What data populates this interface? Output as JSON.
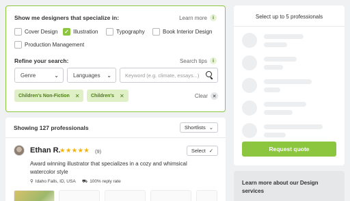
{
  "filters": {
    "specialty_question": "Show me designers that specialize in:",
    "learn_more_label": "Learn more",
    "specialties": [
      {
        "label": "Cover Design",
        "checked": false
      },
      {
        "label": "Illustration",
        "checked": true
      },
      {
        "label": "Typography",
        "checked": false
      },
      {
        "label": "Book Interior Design",
        "checked": false
      },
      {
        "label": "Production Management",
        "checked": false
      }
    ],
    "refine_label": "Refine your search:",
    "search_tips_label": "Search tips",
    "genre_select": "Genre",
    "languages_select": "Languages",
    "keyword_placeholder": "Keyword (e.g. climate, essays...)",
    "active_chips": [
      "Children's Non-Fiction",
      "Children's"
    ],
    "clear_label": "Clear"
  },
  "results": {
    "count_label": "Showing 127 professionals",
    "shortlists_label": "Shortlists",
    "professional": {
      "name": "Ethan R.",
      "stars": "★★★★★",
      "rating": 5,
      "review_count": "(9)",
      "select_label": "Select",
      "description": "Award winning illustrator that specializes in a cozy and whimsical watercolor style",
      "location": "Idaho Falls, ID, USA",
      "reply_rate": "100% reply rate"
    }
  },
  "sidebar": {
    "title": "Select up to 5 professionals",
    "request_quote_label": "Request quote",
    "learn_more_heading": "Learn more about our Design services"
  },
  "icons": {
    "info": "info-icon",
    "chevron": "chevron-down-icon",
    "search": "search-icon",
    "close": "close-icon",
    "check": "check-icon",
    "star": "star-icon",
    "location": "map-pin-icon",
    "reply": "truck-icon"
  },
  "colors": {
    "accent": "#8cc63f",
    "chip_bg": "#dff0c6",
    "chip_text": "#4a7a14",
    "star": "#f5b301"
  }
}
